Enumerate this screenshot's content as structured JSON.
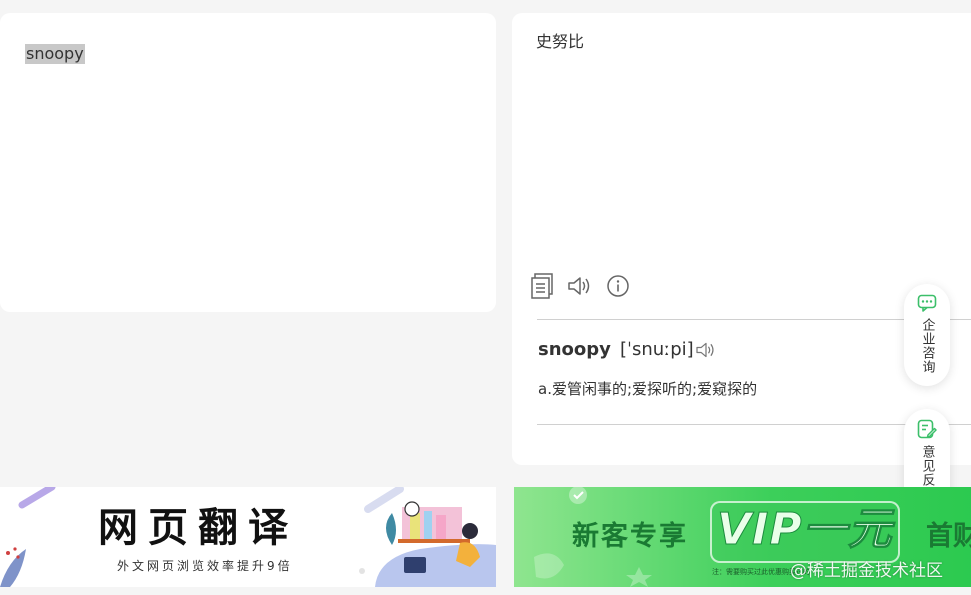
{
  "source": {
    "text": "snoopy"
  },
  "result": {
    "text": "史努比"
  },
  "dictionary": {
    "word": "snoopy",
    "phonetic": "[ˈsnuːpi]",
    "definition": "a.爱管闲事的;爱探听的;爱窥探的"
  },
  "sidebar": {
    "enterprise_label": "企业咨询",
    "feedback_label": "意见反馈"
  },
  "banners": {
    "web_translate": {
      "title": "网页翻译",
      "subtitle": "外文网页浏览效率提升9倍"
    },
    "vip": {
      "left_text": "新客专享",
      "main_text": "VIP一元",
      "right_text": "首财",
      "note": "注：需要购买过此优惠购买过的"
    }
  },
  "watermark": "@稀土掘金技术社区",
  "colors": {
    "accent_green": "#3ccf5a",
    "float_icon": "#3cbf6a"
  },
  "icons": [
    "copy-icon",
    "speaker-icon",
    "info-icon",
    "chat-icon",
    "edit-icon"
  ]
}
